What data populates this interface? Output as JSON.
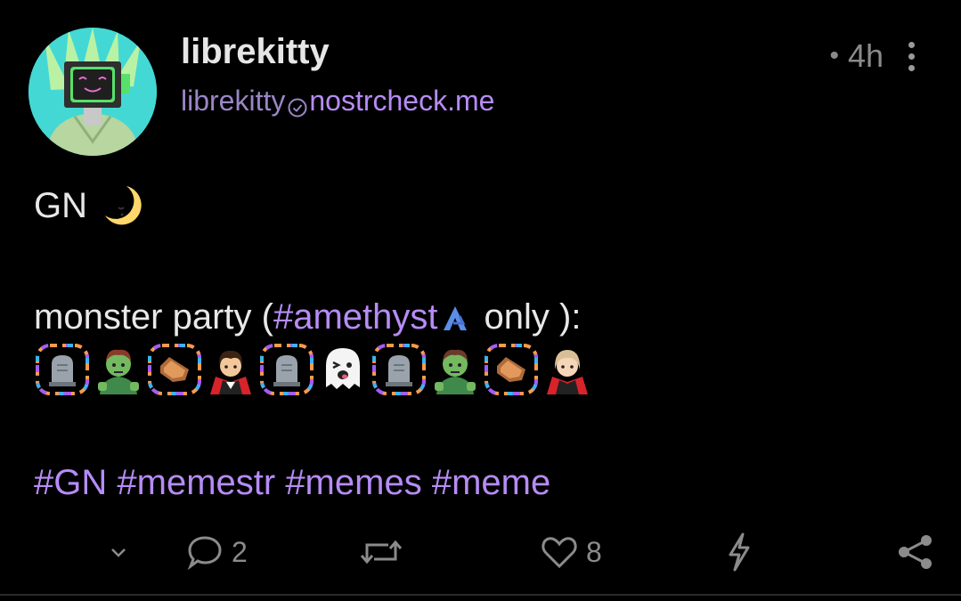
{
  "author": {
    "name": "librekitty",
    "nip05_user": "librekitty",
    "nip05_domain": "nostrcheck.me",
    "avatar_icon": "avatar-monitor-head"
  },
  "meta": {
    "separator": "•",
    "time": "4h"
  },
  "content": {
    "line1_text": "GN",
    "line1_emoji": "crescent-moon-face",
    "line2_text": "monster party ( ",
    "line2_hashtag": "#amethyst",
    "line2_suffix": " only ):",
    "emoji_row": [
      "headstone",
      "zombie",
      "coffin",
      "vampire",
      "headstone",
      "ghost",
      "headstone",
      "zombie",
      "coffin",
      "vampire-light"
    ],
    "hashtags": [
      "#GN",
      "#memestr",
      "#memes",
      "#meme"
    ]
  },
  "actions": {
    "replies": "2",
    "likes": "8"
  },
  "colors": {
    "background": "#000000",
    "accent": "#b68cf5",
    "muted": "#8b8b8b"
  }
}
